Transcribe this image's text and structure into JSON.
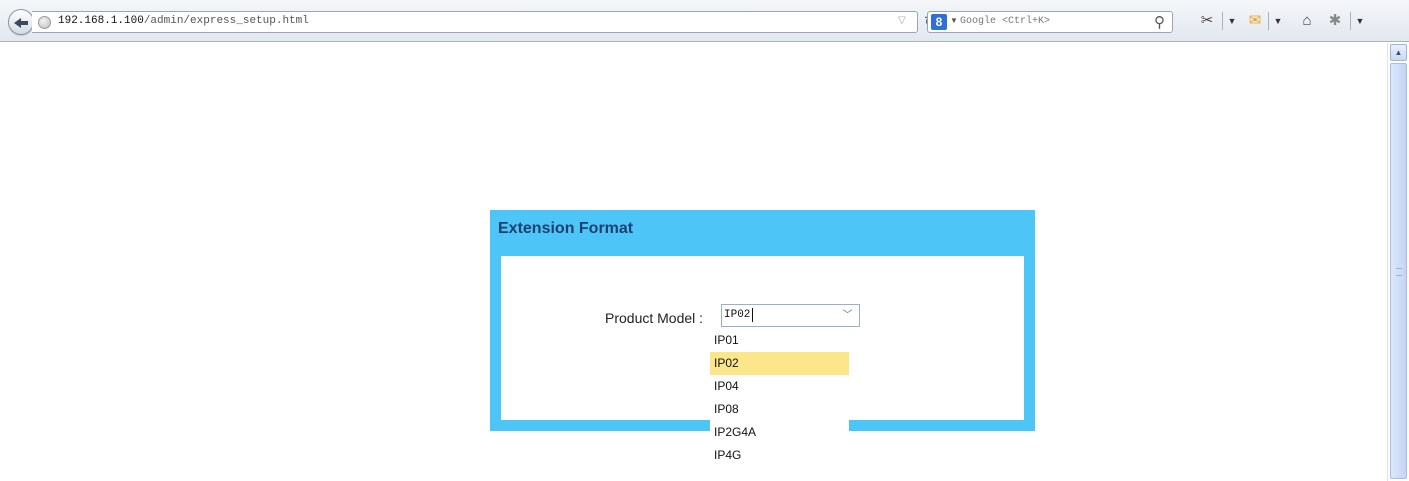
{
  "browser": {
    "url_host": "192.168.1.100",
    "url_path": "/admin/express_setup.html",
    "search_engine_icon_label": "8",
    "search_placeholder": "Google <Ctrl+K>"
  },
  "icons": [
    "back-icon",
    "globe-icon",
    "dropmark-icon",
    "reload-icon",
    "google-icon",
    "magnifier-icon",
    "screenshot-icon",
    "mail-icon",
    "home-icon",
    "addon-icon",
    "menu-dropdown-icon",
    "scroll-up-icon",
    "select-arrow-icon"
  ],
  "panel": {
    "title": "Extension Format",
    "accent_color": "#4ec5f7",
    "title_color": "#1e3f73"
  },
  "form": {
    "product_model_label": "Product Model :",
    "product_model_value": "IP02"
  },
  "dropdown": {
    "options": [
      "IP01",
      "IP02",
      "IP04",
      "IP08",
      "IP2G4A",
      "IP4G"
    ],
    "highlighted": "IP02",
    "highlight_color": "#fbe78a"
  }
}
